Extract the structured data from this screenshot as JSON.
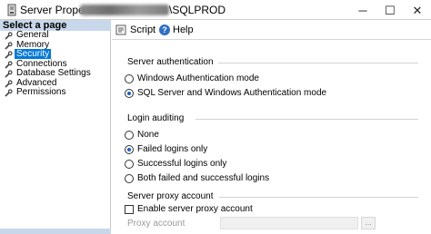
{
  "window": {
    "title_prefix": "Server Properties",
    "title_suffix": "\\SQLPROD",
    "minimize": "─",
    "maximize": "☐",
    "close": "✕"
  },
  "left_pane": {
    "header": "Select a page",
    "items": [
      {
        "label": "General",
        "selected": false
      },
      {
        "label": "Memory",
        "selected": false
      },
      {
        "label": "Security",
        "selected": true
      },
      {
        "label": "Connections",
        "selected": false
      },
      {
        "label": "Database Settings",
        "selected": false
      },
      {
        "label": "Advanced",
        "selected": false
      },
      {
        "label": "Permissions",
        "selected": false
      }
    ]
  },
  "toolbar": {
    "script_label": "Script",
    "help_label": "Help"
  },
  "server_authentication": {
    "title": "Server authentication",
    "options": [
      {
        "label": "Windows Authentication mode",
        "selected": false
      },
      {
        "label": "SQL Server and Windows Authentication mode",
        "selected": true
      }
    ]
  },
  "login_auditing": {
    "title": "Login auditing",
    "options": [
      {
        "label": "None",
        "selected": false
      },
      {
        "label": "Failed logins only",
        "selected": true
      },
      {
        "label": "Successful logins only",
        "selected": false
      },
      {
        "label": "Both failed and successful logins",
        "selected": false
      }
    ]
  },
  "server_proxy": {
    "title": "Server proxy account",
    "enable_label": "Enable server proxy account",
    "enabled": false,
    "proxy_account_label": "Proxy account",
    "proxy_account_value": "",
    "browse_label": "..."
  },
  "colors": {
    "selection": "#0078d7",
    "pane_header": "#c8d7ea"
  }
}
